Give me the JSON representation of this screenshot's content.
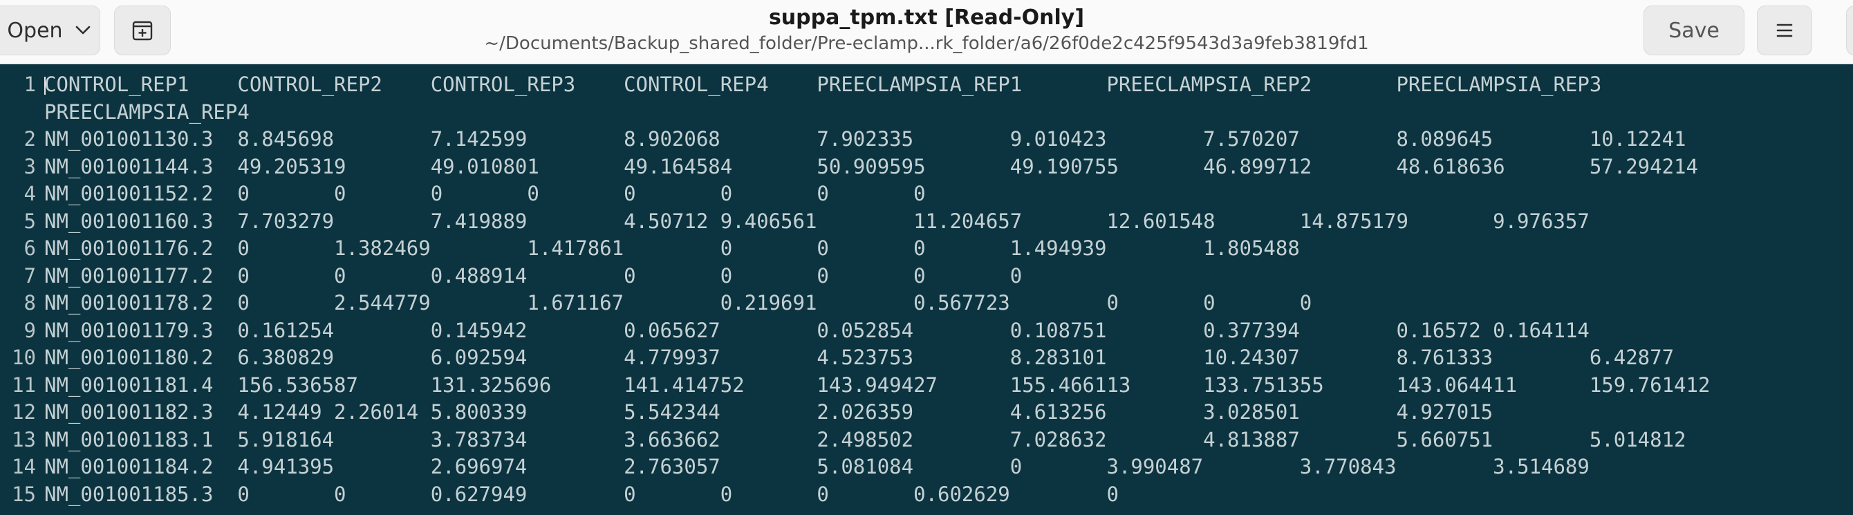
{
  "header": {
    "open_label": "Open",
    "title": "suppa_tpm.txt [Read-Only]",
    "path": "~/Documents/Backup_shared_folder/Pre-eclamp...rk_folder/a6/26f0de2c425f9543d3a9feb3819fd1",
    "save_label": "Save"
  },
  "icons": {
    "open_dropdown": "chevron-down-icon",
    "new_tab": "new-tab-icon",
    "menu": "hamburger-icon"
  },
  "colors": {
    "editor_bg": "#0b3440",
    "text": "#c5d0d3",
    "header_bg": "#fafafa"
  },
  "lines": [
    {
      "num": "1",
      "text": "CONTROL_REP1\tCONTROL_REP2\tCONTROL_REP3\tCONTROL_REP4\tPREECLAMPSIA_REP1\tPREECLAMPSIA_REP2\tPREECLAMPSIA_REP3",
      "wrap": "PREECLAMPSIA_REP4"
    },
    {
      "num": "2",
      "text": "NM_001001130.3\t8.845698\t7.142599\t8.902068\t7.902335\t9.010423\t7.570207\t8.089645\t10.12241"
    },
    {
      "num": "3",
      "text": "NM_001001144.3\t49.205319\t49.010801\t49.164584\t50.909595\t49.190755\t46.899712\t48.618636\t57.294214"
    },
    {
      "num": "4",
      "text": "NM_001001152.2\t0\t0\t0\t0\t0\t0\t0\t0"
    },
    {
      "num": "5",
      "text": "NM_001001160.3\t7.703279\t7.419889\t4.50712\t9.406561\t11.204657\t12.601548\t14.875179\t9.976357"
    },
    {
      "num": "6",
      "text": "NM_001001176.2\t0\t1.382469\t1.417861\t0\t0\t0\t1.494939\t1.805488"
    },
    {
      "num": "7",
      "text": "NM_001001177.2\t0\t0\t0.488914\t0\t0\t0\t0\t0"
    },
    {
      "num": "8",
      "text": "NM_001001178.2\t0\t2.544779\t1.671167\t0.219691\t0.567723\t0\t0\t0"
    },
    {
      "num": "9",
      "text": "NM_001001179.3\t0.161254\t0.145942\t0.065627\t0.052854\t0.108751\t0.377394\t0.16572\t0.164114"
    },
    {
      "num": "10",
      "text": "NM_001001180.2\t6.380829\t6.092594\t4.779937\t4.523753\t8.283101\t10.24307\t8.761333\t6.42877"
    },
    {
      "num": "11",
      "text": "NM_001001181.4\t156.536587\t131.325696\t141.414752\t143.949427\t155.466113\t133.751355\t143.064411\t159.761412"
    },
    {
      "num": "12",
      "text": "NM_001001182.3\t4.12449\t2.26014\t5.800339\t5.542344\t2.026359\t4.613256\t3.028501\t4.927015"
    },
    {
      "num": "13",
      "text": "NM_001001183.1\t5.918164\t3.783734\t3.663662\t2.498502\t7.028632\t4.813887\t5.660751\t5.014812"
    },
    {
      "num": "14",
      "text": "NM_001001184.2\t4.941395\t2.696974\t2.763057\t5.081084\t0\t3.990487\t3.770843\t3.514689"
    },
    {
      "num": "15",
      "text": "NM_001001185.3\t0\t0\t0.627949\t0\t0\t0\t0.602629\t0"
    }
  ]
}
